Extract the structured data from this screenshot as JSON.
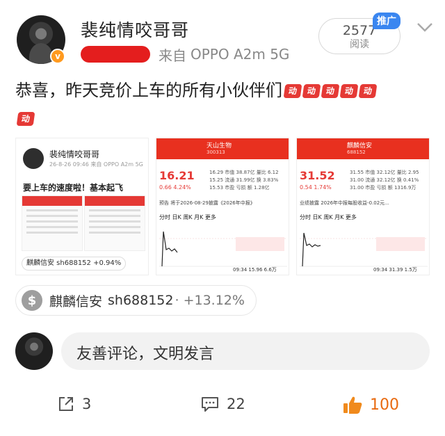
{
  "post": {
    "username": "裴纯情咬哥哥",
    "source_prefix": "来自",
    "device": "OPPO A2m 5G",
    "read_count": "2577",
    "read_label": "阅读",
    "promo_badge": "推广",
    "text": "恭喜，昨天竞价上车的所有小伙伴们",
    "emoji_label": "动"
  },
  "images": {
    "thumb1": {
      "name": "裴纯情咬哥哥",
      "meta": "26-8-26 09:46 来自 OPPO A2m 5G",
      "caption": "要上车的速度啦！基本起飞",
      "chip": "麒麟信安 sh688152 +0.94%"
    },
    "thumb2": {
      "name": "天山生物",
      "code": "300313",
      "price": "16.21",
      "change": "0.66  4.24%",
      "grid": [
        "16.29  市值 38.87亿  量比 6.12",
        "15.25  流通 31.99亿  换 3.83%",
        "15.53  市盈  亏损  额 1.28亿"
      ],
      "notice": "预告 将于2026-08-29披露《2026年中报》",
      "tabs": "分时   日K   周K   月K   更多",
      "footer": "09:34  15.96  6.6万"
    },
    "thumb3": {
      "name": "麒麟信安",
      "code": "688152",
      "price": "31.52",
      "change": "0.54  1.74%",
      "grid": [
        "31.55  市值 32.12亿  量比 2.95",
        "31.00  流通 32.12亿  换 0.41%",
        "31.00  市盈  亏损  额 1316.9万"
      ],
      "notice": "业绩披露 2026年中报每股收益-0.02元...",
      "tabs": "分时   日K   周K   月K   更多",
      "footer": "09:34  31.39  1.5万"
    }
  },
  "stock_chip": {
    "symbol": "$",
    "name": "麒麟信安",
    "code": "sh688152",
    "change": "· +13.12%"
  },
  "comment": {
    "placeholder": "友善评论，文明发言"
  },
  "actions": {
    "share_count": "3",
    "comment_count": "22",
    "like_count": "100"
  },
  "colors": {
    "accent_red": "#e53935",
    "like_orange": "#e86a10",
    "promo_blue": "#3a86f0"
  }
}
